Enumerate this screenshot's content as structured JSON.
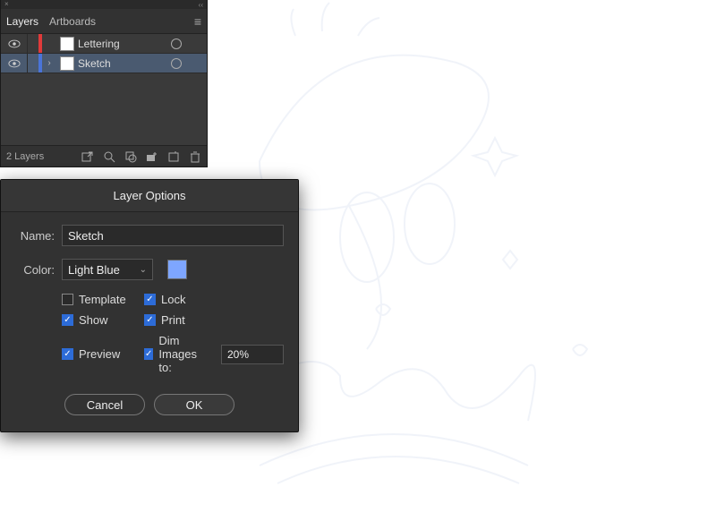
{
  "layers_panel": {
    "tabs": [
      {
        "label": "Layers",
        "active": true
      },
      {
        "label": "Artboards",
        "active": false
      }
    ],
    "layers": [
      {
        "name": "Lettering",
        "color": "#e03a3a",
        "visible": true,
        "selected": false,
        "expandable": false
      },
      {
        "name": "Sketch",
        "color": "#4a74d8",
        "visible": true,
        "selected": true,
        "expandable": true
      }
    ],
    "footer": {
      "count_label": "2 Layers"
    }
  },
  "layer_options": {
    "title": "Layer Options",
    "name_label": "Name:",
    "name_value": "Sketch",
    "color_label": "Color:",
    "color_selected": "Light Blue",
    "color_swatch": "#7ea6ff",
    "checkboxes": {
      "template": {
        "label": "Template",
        "checked": false
      },
      "lock": {
        "label": "Lock",
        "checked": true
      },
      "show": {
        "label": "Show",
        "checked": true
      },
      "print": {
        "label": "Print",
        "checked": true
      },
      "preview": {
        "label": "Preview",
        "checked": true
      },
      "dim": {
        "label": "Dim Images to:",
        "checked": true,
        "value": "20%"
      }
    },
    "buttons": {
      "cancel": "Cancel",
      "ok": "OK"
    }
  }
}
